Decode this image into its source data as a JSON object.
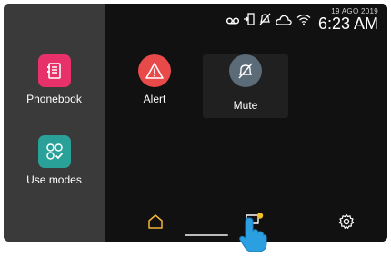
{
  "status": {
    "date": "19 AGO 2019",
    "time": "6:23 AM",
    "icons": [
      "voicemail-icon",
      "door-exit-icon",
      "ringer-off-icon",
      "cloud-icon",
      "wifi-icon"
    ]
  },
  "sidebar": {
    "items": [
      {
        "label": "Phonebook",
        "icon": "phonebook-icon",
        "color": "#e8306a"
      },
      {
        "label": "Use modes",
        "icon": "use-modes-icon",
        "color": "#2aa198"
      }
    ]
  },
  "main": {
    "tiles": [
      {
        "label": "Alert",
        "icon": "alert-icon",
        "color": "#e84a4a"
      },
      {
        "label": "Mute",
        "icon": "mute-icon",
        "color": "#5b6b78"
      }
    ]
  },
  "nav": {
    "items": [
      "home-icon",
      "messages-icon",
      "settings-icon"
    ],
    "accent": "#f2b33d",
    "badge_color": "#f5c028"
  }
}
